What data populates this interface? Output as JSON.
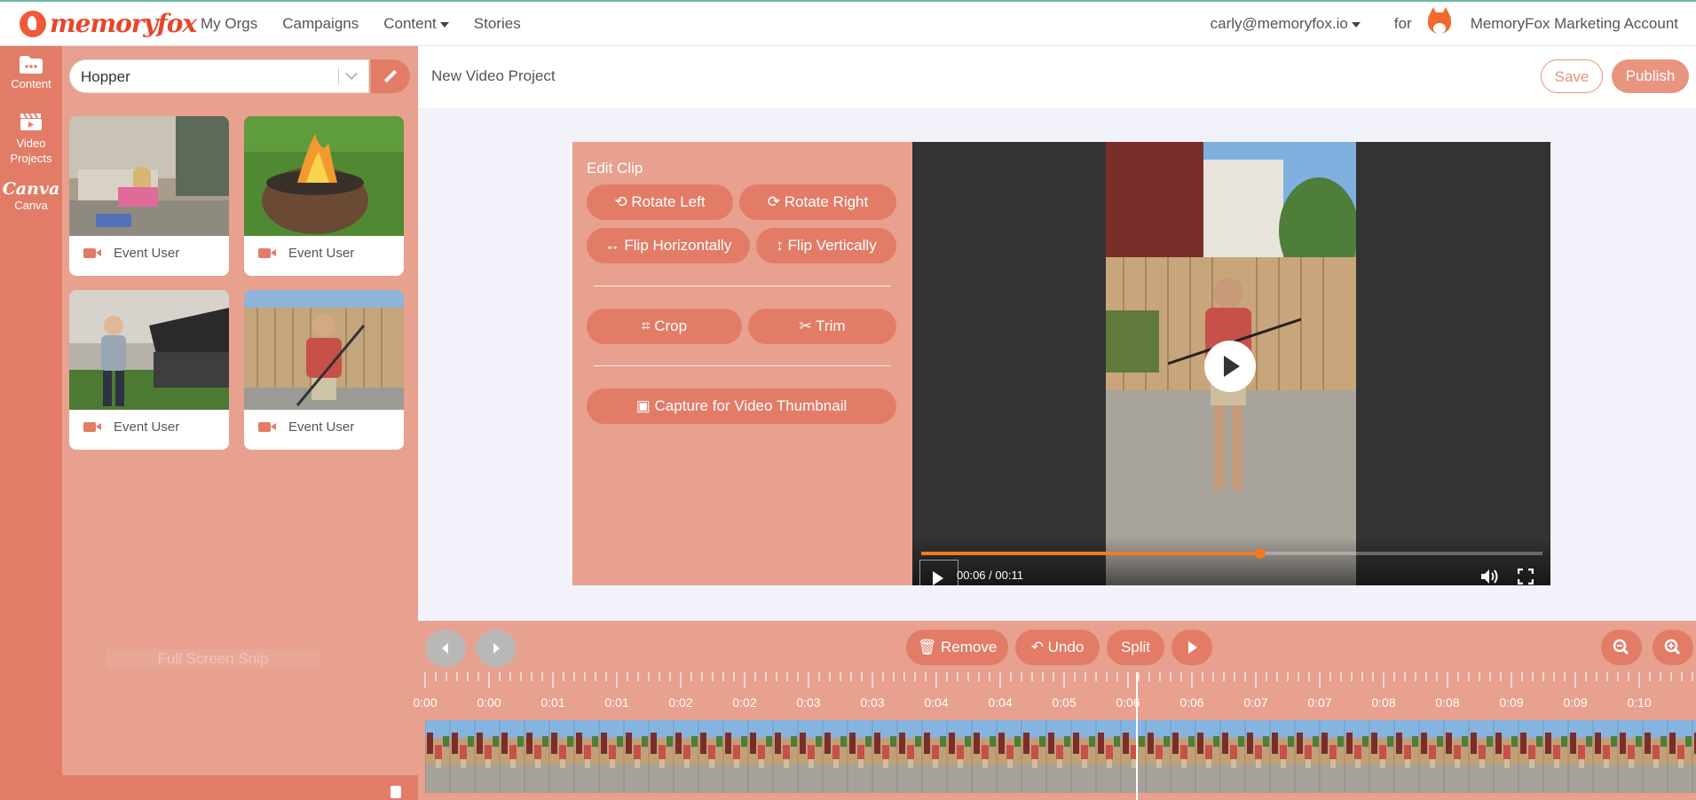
{
  "brand": {
    "logo_text": "memoryfox",
    "accent": "#e27c67",
    "panel_bg": "#e8a08f"
  },
  "nav": {
    "items": [
      "My Orgs",
      "Campaigns",
      "Content",
      "Stories"
    ]
  },
  "account": {
    "email": "carly@memoryfox.io",
    "for_label": "for",
    "org_name": "MemoryFox Marketing Account"
  },
  "sidebar": {
    "items": [
      {
        "label": "Content",
        "icon": "folder-icon"
      },
      {
        "label": "Video Projects",
        "icon": "clapperboard-icon"
      },
      {
        "label": "Canva",
        "icon": "canva-logo"
      }
    ]
  },
  "library": {
    "search_value": "Hopper",
    "cards": [
      {
        "caption": "Event User",
        "icon": "video-camera-icon"
      },
      {
        "caption": "Event User",
        "icon": "video-camera-icon"
      },
      {
        "caption": "Event User",
        "icon": "video-camera-icon"
      },
      {
        "caption": "Event User",
        "icon": "video-camera-icon"
      }
    ],
    "ghost_text": "Full Screen Snip"
  },
  "project": {
    "title": "New Video Project",
    "save_label": "Save",
    "publish_label": "Publish"
  },
  "edit_clip": {
    "title": "Edit Clip",
    "buttons": {
      "rotate_left": "Rotate Left",
      "rotate_right": "Rotate Right",
      "flip_h": "Flip Horizontally",
      "flip_v": "Flip Vertically",
      "crop": "Crop",
      "trim": "Trim",
      "capture": "Capture for Video Thumbnail"
    }
  },
  "player": {
    "time": "00:06 / 00:11",
    "progress": 0.545
  },
  "timeline": {
    "remove_label": "Remove",
    "undo_label": "Undo",
    "split_label": "Split",
    "ticks": [
      "0:00",
      "0:00",
      "0:01",
      "0:01",
      "0:02",
      "0:02",
      "0:03",
      "0:03",
      "0:04",
      "0:04",
      "0:05",
      "0:06",
      "0:06",
      "0:07",
      "0:07",
      "0:08",
      "0:08",
      "0:09",
      "0:09",
      "0:10"
    ]
  }
}
